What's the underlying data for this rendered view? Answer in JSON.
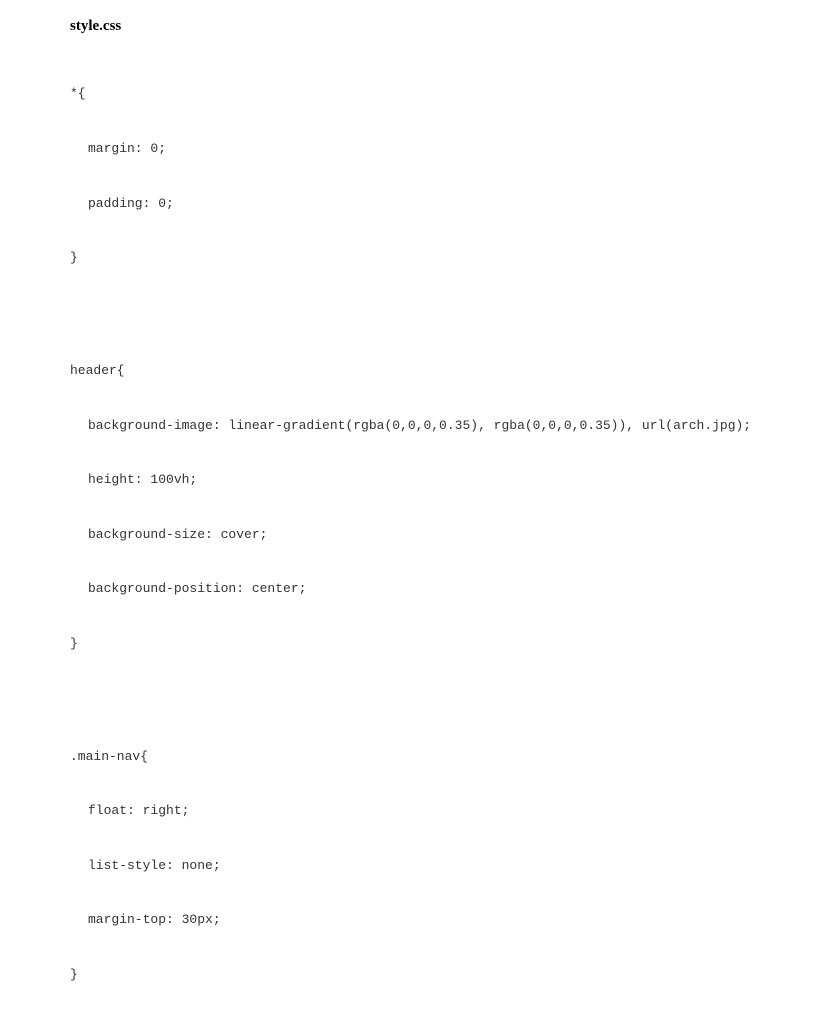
{
  "filename": "style.css",
  "lines": {
    "l1": "*{",
    "l2": "margin: 0;",
    "l3": "padding: 0;",
    "l4": "}",
    "l5": "header{",
    "l6": "background-image: linear-gradient(rgba(0,0,0,0.35), rgba(0,0,0,0.35)), url(arch.jpg);",
    "l7": "height: 100vh;",
    "l8": "background-size: cover;",
    "l9": "background-position: center;",
    "l10": "}",
    "l11": ".main-nav{",
    "l12": "float: right;",
    "l13": "list-style: none;",
    "l14": "margin-top: 30px;",
    "l15": "}"
  }
}
